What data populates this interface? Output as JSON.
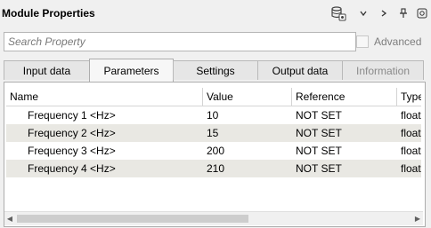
{
  "title": "Module Properties",
  "toolbar": {
    "db_icon": "database-settings-icon",
    "menu_icon": "chevron-down-icon",
    "next_icon": "chevron-right-icon",
    "pin_icon": "pin-icon",
    "close_icon": "close-icon"
  },
  "search": {
    "placeholder": "Search Property",
    "value": ""
  },
  "advanced": {
    "label": "Advanced",
    "checked": false
  },
  "tabs": [
    {
      "label": "Input data",
      "active": false,
      "enabled": true
    },
    {
      "label": "Parameters",
      "active": true,
      "enabled": true
    },
    {
      "label": "Settings",
      "active": false,
      "enabled": true
    },
    {
      "label": "Output data",
      "active": false,
      "enabled": true
    },
    {
      "label": "Information",
      "active": false,
      "enabled": false
    }
  ],
  "table": {
    "headers": [
      "Name",
      "Value",
      "Reference",
      "Type"
    ],
    "rows": [
      {
        "name": "Frequency 1 <Hz>",
        "value": "10",
        "reference": "NOT SET",
        "type": "float"
      },
      {
        "name": "Frequency 2 <Hz>",
        "value": "15",
        "reference": "NOT SET",
        "type": "float"
      },
      {
        "name": "Frequency 3 <Hz>",
        "value": "200",
        "reference": "NOT SET",
        "type": "float"
      },
      {
        "name": "Frequency 4 <Hz>",
        "value": "210",
        "reference": "NOT SET",
        "type": "float"
      }
    ]
  },
  "scrollbar": {
    "left_icon": "arrow-left-icon",
    "right_icon": "arrow-right-icon"
  }
}
